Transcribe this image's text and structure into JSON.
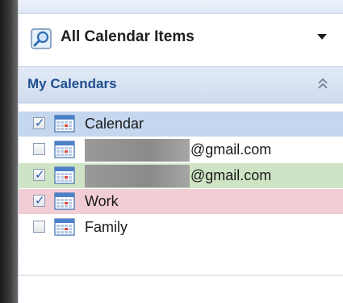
{
  "view_selector": {
    "label": "All Calendar Items",
    "icon": "search-icon",
    "dropdown_icon": "chevron-down-icon"
  },
  "section": {
    "title": "My Calendars",
    "collapse_icon": "double-chevron-up-icon"
  },
  "calendars": [
    {
      "name": "Calendar",
      "checked": true,
      "redacted": false,
      "suffix": "",
      "row_color": "#c5d7ee"
    },
    {
      "name": "",
      "checked": false,
      "redacted": true,
      "suffix": "@gmail.com",
      "row_color": "#ffffff"
    },
    {
      "name": "",
      "checked": true,
      "redacted": true,
      "suffix": "@gmail.com",
      "row_color": "#cfe4c4"
    },
    {
      "name": "Work",
      "checked": true,
      "redacted": false,
      "suffix": "",
      "row_color": "#f1cdd6"
    },
    {
      "name": "Family",
      "checked": false,
      "redacted": false,
      "suffix": "",
      "row_color": "#ffffff"
    }
  ],
  "colors": {
    "header_text": "#1f4e8c",
    "check_mark": "#2a5fb0"
  }
}
